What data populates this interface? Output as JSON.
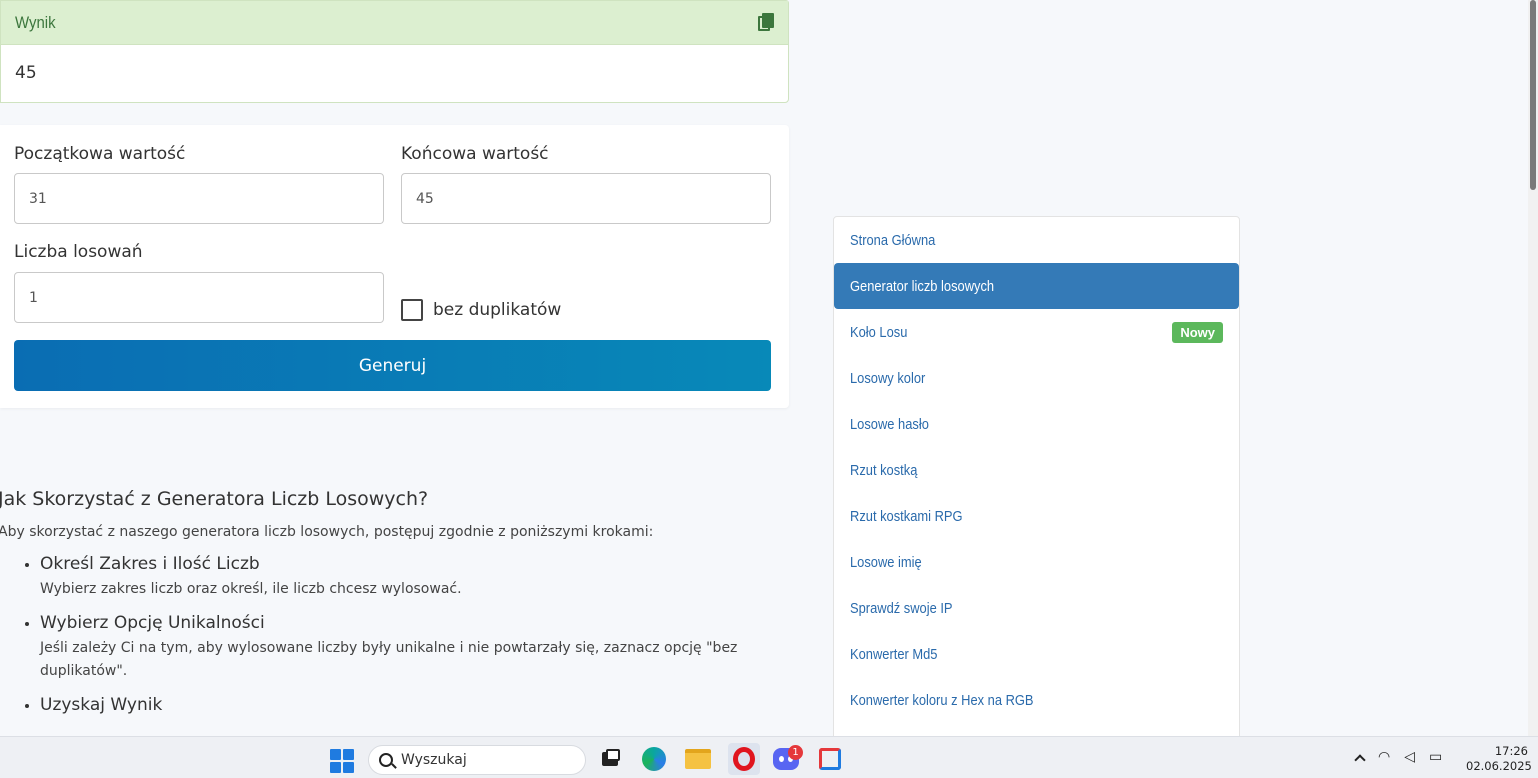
{
  "result": {
    "title": "Wynik",
    "value": "45"
  },
  "form": {
    "start_label": "Początkowa wartość",
    "start_value": "31",
    "end_label": "Końcowa wartość",
    "end_value": "45",
    "count_label": "Liczba losowań",
    "count_value": "1",
    "no_duplicates_label": "bez duplikatów",
    "no_duplicates_checked": false,
    "generate_label": "Generuj"
  },
  "article": {
    "heading": "Jak Skorzystać z Generatora Liczb Losowych?",
    "intro": "Aby skorzystać z naszego generatora liczb losowych, postępuj zgodnie z poniższymi krokami:",
    "steps": [
      {
        "title": "Określ Zakres i Ilość Liczb",
        "desc": "Wybierz zakres liczb oraz określ, ile liczb chcesz wylosować."
      },
      {
        "title": "Wybierz Opcję Unikalności",
        "desc": "Jeśli zależy Ci na tym, aby wylosowane liczby były unikalne i nie powtarzały się, zaznacz opcję \"bez duplikatów\"."
      },
      {
        "title": "Uzyskaj Wynik",
        "desc": ""
      }
    ]
  },
  "menu": {
    "items": [
      {
        "label": "Strona Główna",
        "active": false
      },
      {
        "label": "Generator liczb losowych",
        "active": true
      },
      {
        "label": "Koło Losu",
        "active": false,
        "badge": "Nowy"
      },
      {
        "label": "Losowy kolor",
        "active": false
      },
      {
        "label": "Losowe hasło",
        "active": false
      },
      {
        "label": "Rzut kostką",
        "active": false
      },
      {
        "label": "Rzut kostkami RPG",
        "active": false
      },
      {
        "label": "Losowe imię",
        "active": false
      },
      {
        "label": "Sprawdź swoje IP",
        "active": false
      },
      {
        "label": "Konwerter Md5",
        "active": false
      },
      {
        "label": "Konwerter koloru z Hex na RGB",
        "active": false
      }
    ]
  },
  "taskbar": {
    "search_placeholder": "Wyszukaj",
    "discord_notifications": "1",
    "time": "17:26",
    "date": "02.06.2025"
  },
  "colors": {
    "accent": "#347ab7",
    "success": "#5cb85c",
    "button_start": "#0a6db3",
    "button_end": "#0889b8"
  }
}
